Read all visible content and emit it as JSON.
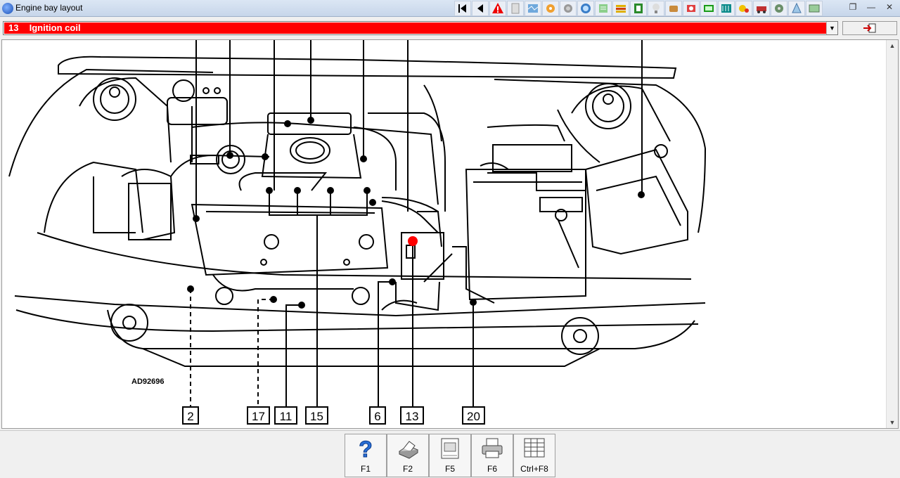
{
  "window": {
    "title": "Engine bay layout",
    "controls": [
      "minimize",
      "maximize",
      "close"
    ]
  },
  "toolbar": {
    "icons": [
      "first-icon",
      "previous-icon",
      "warning-icon",
      "page-icon",
      "map-icon",
      "wrench-icon",
      "disc-icon",
      "gauge-icon",
      "lines-icon",
      "fuse-icon",
      "tool-icon",
      "bulb-icon",
      "hand-icon",
      "screen-icon",
      "film-icon",
      "spark-icon",
      "car-icon",
      "gear-icon",
      "jack-icon",
      "money-icon",
      "notes-icon"
    ]
  },
  "selector": {
    "number": "13",
    "label": "Ignition coil",
    "highlight_color": "#ff0000"
  },
  "diagram": {
    "reference": "AD92696",
    "top_leaders": [
      "",
      "",
      "",
      "",
      "",
      "",
      ""
    ],
    "callouts": [
      {
        "label": "2"
      },
      {
        "label": "17"
      },
      {
        "label": "11"
      },
      {
        "label": "15"
      },
      {
        "label": "6"
      },
      {
        "label": "13",
        "selected": true
      },
      {
        "label": "20"
      }
    ]
  },
  "function_keys": [
    {
      "key": "F1",
      "icon": "help-icon"
    },
    {
      "key": "F2",
      "icon": "print-setup-icon"
    },
    {
      "key": "F5",
      "icon": "notepad-icon"
    },
    {
      "key": "F6",
      "icon": "printer-icon"
    },
    {
      "key": "Ctrl+F8",
      "icon": "table-icon"
    }
  ]
}
